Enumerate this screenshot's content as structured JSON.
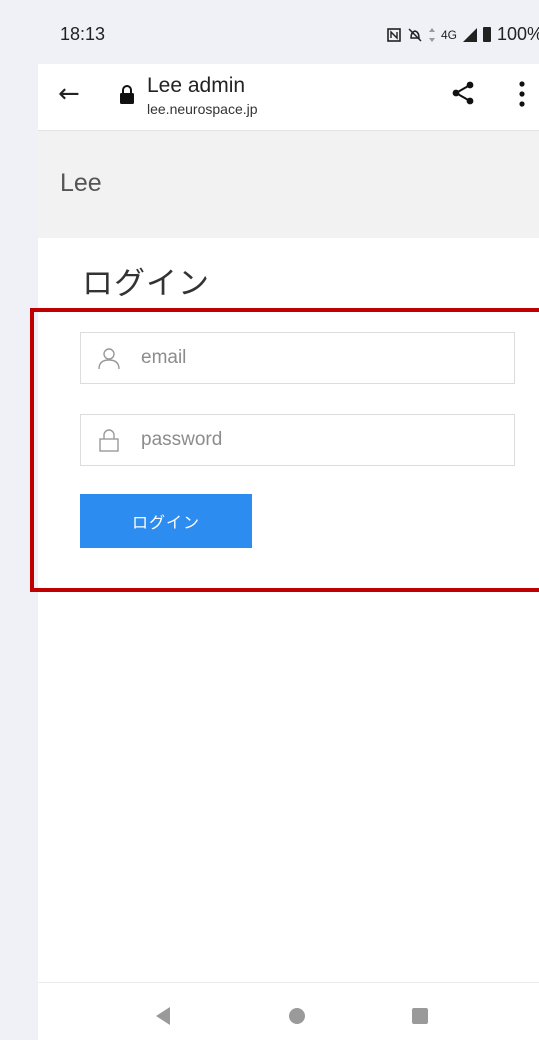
{
  "status_bar": {
    "time": "18:13",
    "network": "4G",
    "battery": "100%",
    "icons": [
      "nfc-icon",
      "mute-icon",
      "data-arrows-icon",
      "signal-icon",
      "battery-icon"
    ]
  },
  "browser": {
    "title": "Lee admin",
    "url": "lee.neurospace.jp",
    "icons": [
      "back-arrow-icon",
      "lock-icon",
      "share-icon",
      "more-vert-icon"
    ]
  },
  "site": {
    "brand": "Lee"
  },
  "login": {
    "heading": "ログイン",
    "email": {
      "placeholder": "email",
      "value": "",
      "icon": "user-icon"
    },
    "password": {
      "placeholder": "password",
      "value": "",
      "icon": "lock-icon"
    },
    "button_label": "ログイン"
  },
  "nav_bar": {
    "icons": [
      "nav-back-icon",
      "nav-home-icon",
      "nav-recents-icon"
    ]
  },
  "colors": {
    "primary_button": "#2d8cf0",
    "highlight_border": "#c00000",
    "header_background": "#f2f2f2",
    "outer_background": "#eff1f6"
  }
}
